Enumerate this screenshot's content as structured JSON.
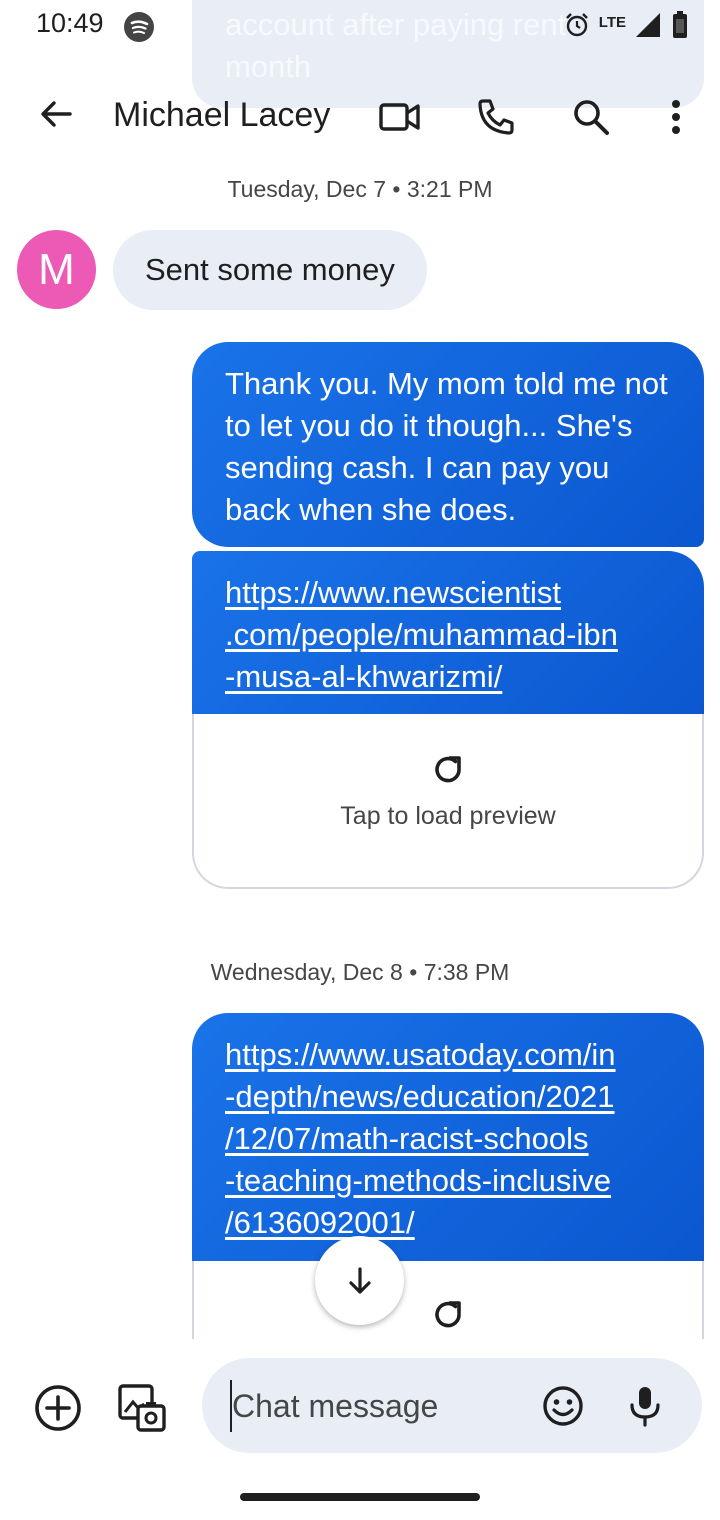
{
  "status_bar": {
    "time": "10:49",
    "network": "LTE",
    "icons": [
      "spotify-icon",
      "alarm-icon",
      "signal-icon",
      "battery-icon"
    ]
  },
  "peek_message": {
    "text": "account after paying rent\nmonth"
  },
  "header": {
    "contact_name": "Michael Lacey",
    "icons": [
      "back-arrow-icon",
      "video-call-icon",
      "phone-icon",
      "search-icon",
      "more-vert-icon"
    ]
  },
  "conversation": {
    "divider_1": {
      "day": "Tuesday, Dec 7",
      "time": "3:21 PM"
    },
    "incoming": {
      "avatar_letter": "M",
      "avatar_color": "#ec5ab6",
      "text": "Sent some money"
    },
    "outgoing_1": {
      "text": "Thank you. My mom told me not to let you do it though... She's sending cash. I can pay you back when she does."
    },
    "link_1": {
      "url": "https://www.newscientist.com/people/muhammad-ibn-musa-al-khwarizmi/",
      "display": "https://www.newscientist\n.com/people/muhammad-ibn\n-musa-al-khwarizmi/",
      "preview_label": "Tap to load preview"
    },
    "divider_2": {
      "day": "Wednesday, Dec 8",
      "time": "7:38 PM"
    },
    "link_2": {
      "url": "https://www.usatoday.com/in-depth/news/education/2021/12/07/math-racist-schools-teaching-methods-inclusive/6136092001/",
      "display": "https://www.usatoday.com/in\n-depth/news/education/2021\n/12/07/math-racist-schools\n-teaching-methods-inclusive\n/6136092001/"
    }
  },
  "compose": {
    "placeholder": "Chat message",
    "icons": [
      "add-icon",
      "gallery-icon",
      "emoji-icon",
      "mic-icon"
    ]
  },
  "colors": {
    "outgoing_bubble": "#1a73e8",
    "incoming_bubble": "#e9eef6",
    "avatar": "#ec5ab6"
  }
}
